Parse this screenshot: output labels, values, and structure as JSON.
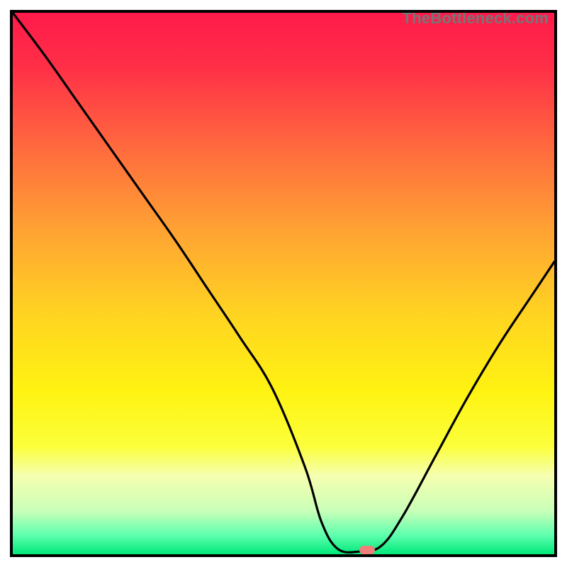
{
  "watermark": "TheBottleneck.com",
  "chart_data": {
    "type": "line",
    "title": "",
    "xlabel": "",
    "ylabel": "",
    "xlim": [
      0,
      100
    ],
    "ylim": [
      0,
      100
    ],
    "gradient_stops": [
      {
        "offset": 0.0,
        "color": "#ff1a4b"
      },
      {
        "offset": 0.1,
        "color": "#ff2f47"
      },
      {
        "offset": 0.25,
        "color": "#ff6a3e"
      },
      {
        "offset": 0.4,
        "color": "#ffa233"
      },
      {
        "offset": 0.55,
        "color": "#ffd222"
      },
      {
        "offset": 0.7,
        "color": "#fff312"
      },
      {
        "offset": 0.8,
        "color": "#fbff3a"
      },
      {
        "offset": 0.855,
        "color": "#f6ffb0"
      },
      {
        "offset": 0.92,
        "color": "#c9ffb8"
      },
      {
        "offset": 0.965,
        "color": "#5dffae"
      },
      {
        "offset": 1.0,
        "color": "#00e879"
      }
    ],
    "series": [
      {
        "name": "bottleneck-curve",
        "x": [
          0.0,
          6.0,
          12.0,
          18.0,
          24.0,
          30.0,
          36.0,
          42.0,
          48.0,
          54.0,
          57.0,
          60.0,
          64.0,
          68.0,
          72.0,
          78.0,
          84.0,
          90.0,
          96.0,
          100.0
        ],
        "y": [
          100.0,
          92.0,
          83.5,
          75.0,
          66.5,
          58.0,
          49.0,
          40.0,
          30.5,
          16.0,
          6.0,
          1.0,
          0.5,
          1.5,
          7.0,
          18.0,
          29.0,
          39.0,
          48.0,
          54.0
        ]
      }
    ],
    "marker": {
      "x": 65.5,
      "y": 0.8,
      "color": "#ee7f7a"
    }
  }
}
